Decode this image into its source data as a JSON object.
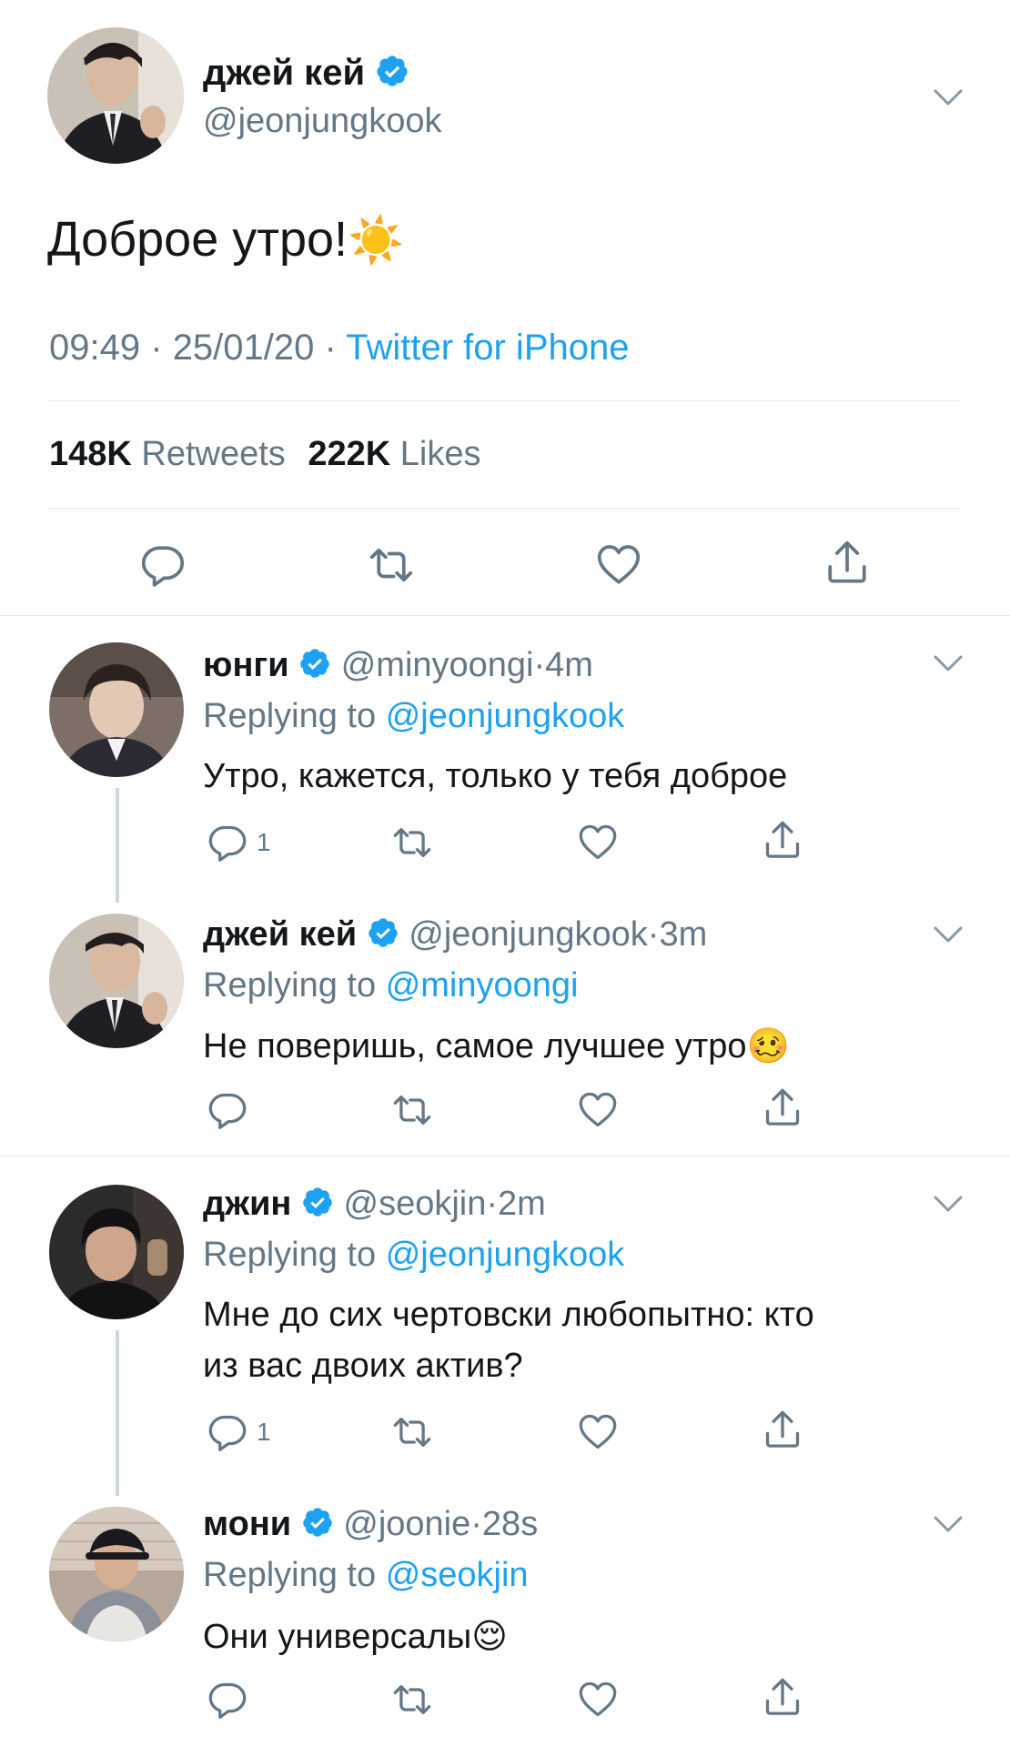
{
  "main_tweet": {
    "display_name": "джей кей",
    "handle": "@jeonjungkook",
    "text": "Доброе утро!",
    "emoji": "☀️",
    "time": "09:49",
    "date": "25/01/20",
    "sep1": "·",
    "sep2": "·",
    "client": "Twitter for iPhone",
    "retweets_count": "148K",
    "retweets_label": "Retweets",
    "likes_count": "222K",
    "likes_label": "Likes"
  },
  "replies": [
    {
      "display_name": "юнги",
      "handle": "@minyoongi",
      "sep": "·",
      "age": "4m",
      "replying_prefix": "Replying to",
      "replying_to": "@jeonjungkook",
      "text": "Утро, кажется, только у тебя доброе",
      "reply_count": "1"
    },
    {
      "display_name": "джей кей",
      "handle": "@jeonjungkook",
      "sep": "·",
      "age": "3m",
      "replying_prefix": "Replying to",
      "replying_to": "@minyoongi",
      "text": "Не поверишь, самое лучшее утро",
      "emoji": "🥴",
      "reply_count": ""
    },
    {
      "display_name": "джин",
      "handle": "@seokjin",
      "sep": "·",
      "age": "2m",
      "replying_prefix": "Replying to",
      "replying_to": "@jeonjungkook",
      "text_line1": "Мне до сих чертовски любопытно: кто",
      "text_line2": "из вас двоих актив?",
      "reply_count": "1"
    },
    {
      "display_name": "мони",
      "handle": "@joonie",
      "sep": "·",
      "age": "28s",
      "replying_prefix": "Replying to",
      "replying_to": "@seokjin",
      "text": "Они универсалы",
      "emoji": "😌",
      "reply_count": ""
    }
  ],
  "icons": [
    "reply-icon",
    "retweet-icon",
    "like-icon",
    "share-icon",
    "verified-badge-icon",
    "chevron-down-icon"
  ],
  "colors": {
    "accent": "#1da1f2",
    "secondary_text": "#657786",
    "divider": "#e1e8ed"
  }
}
